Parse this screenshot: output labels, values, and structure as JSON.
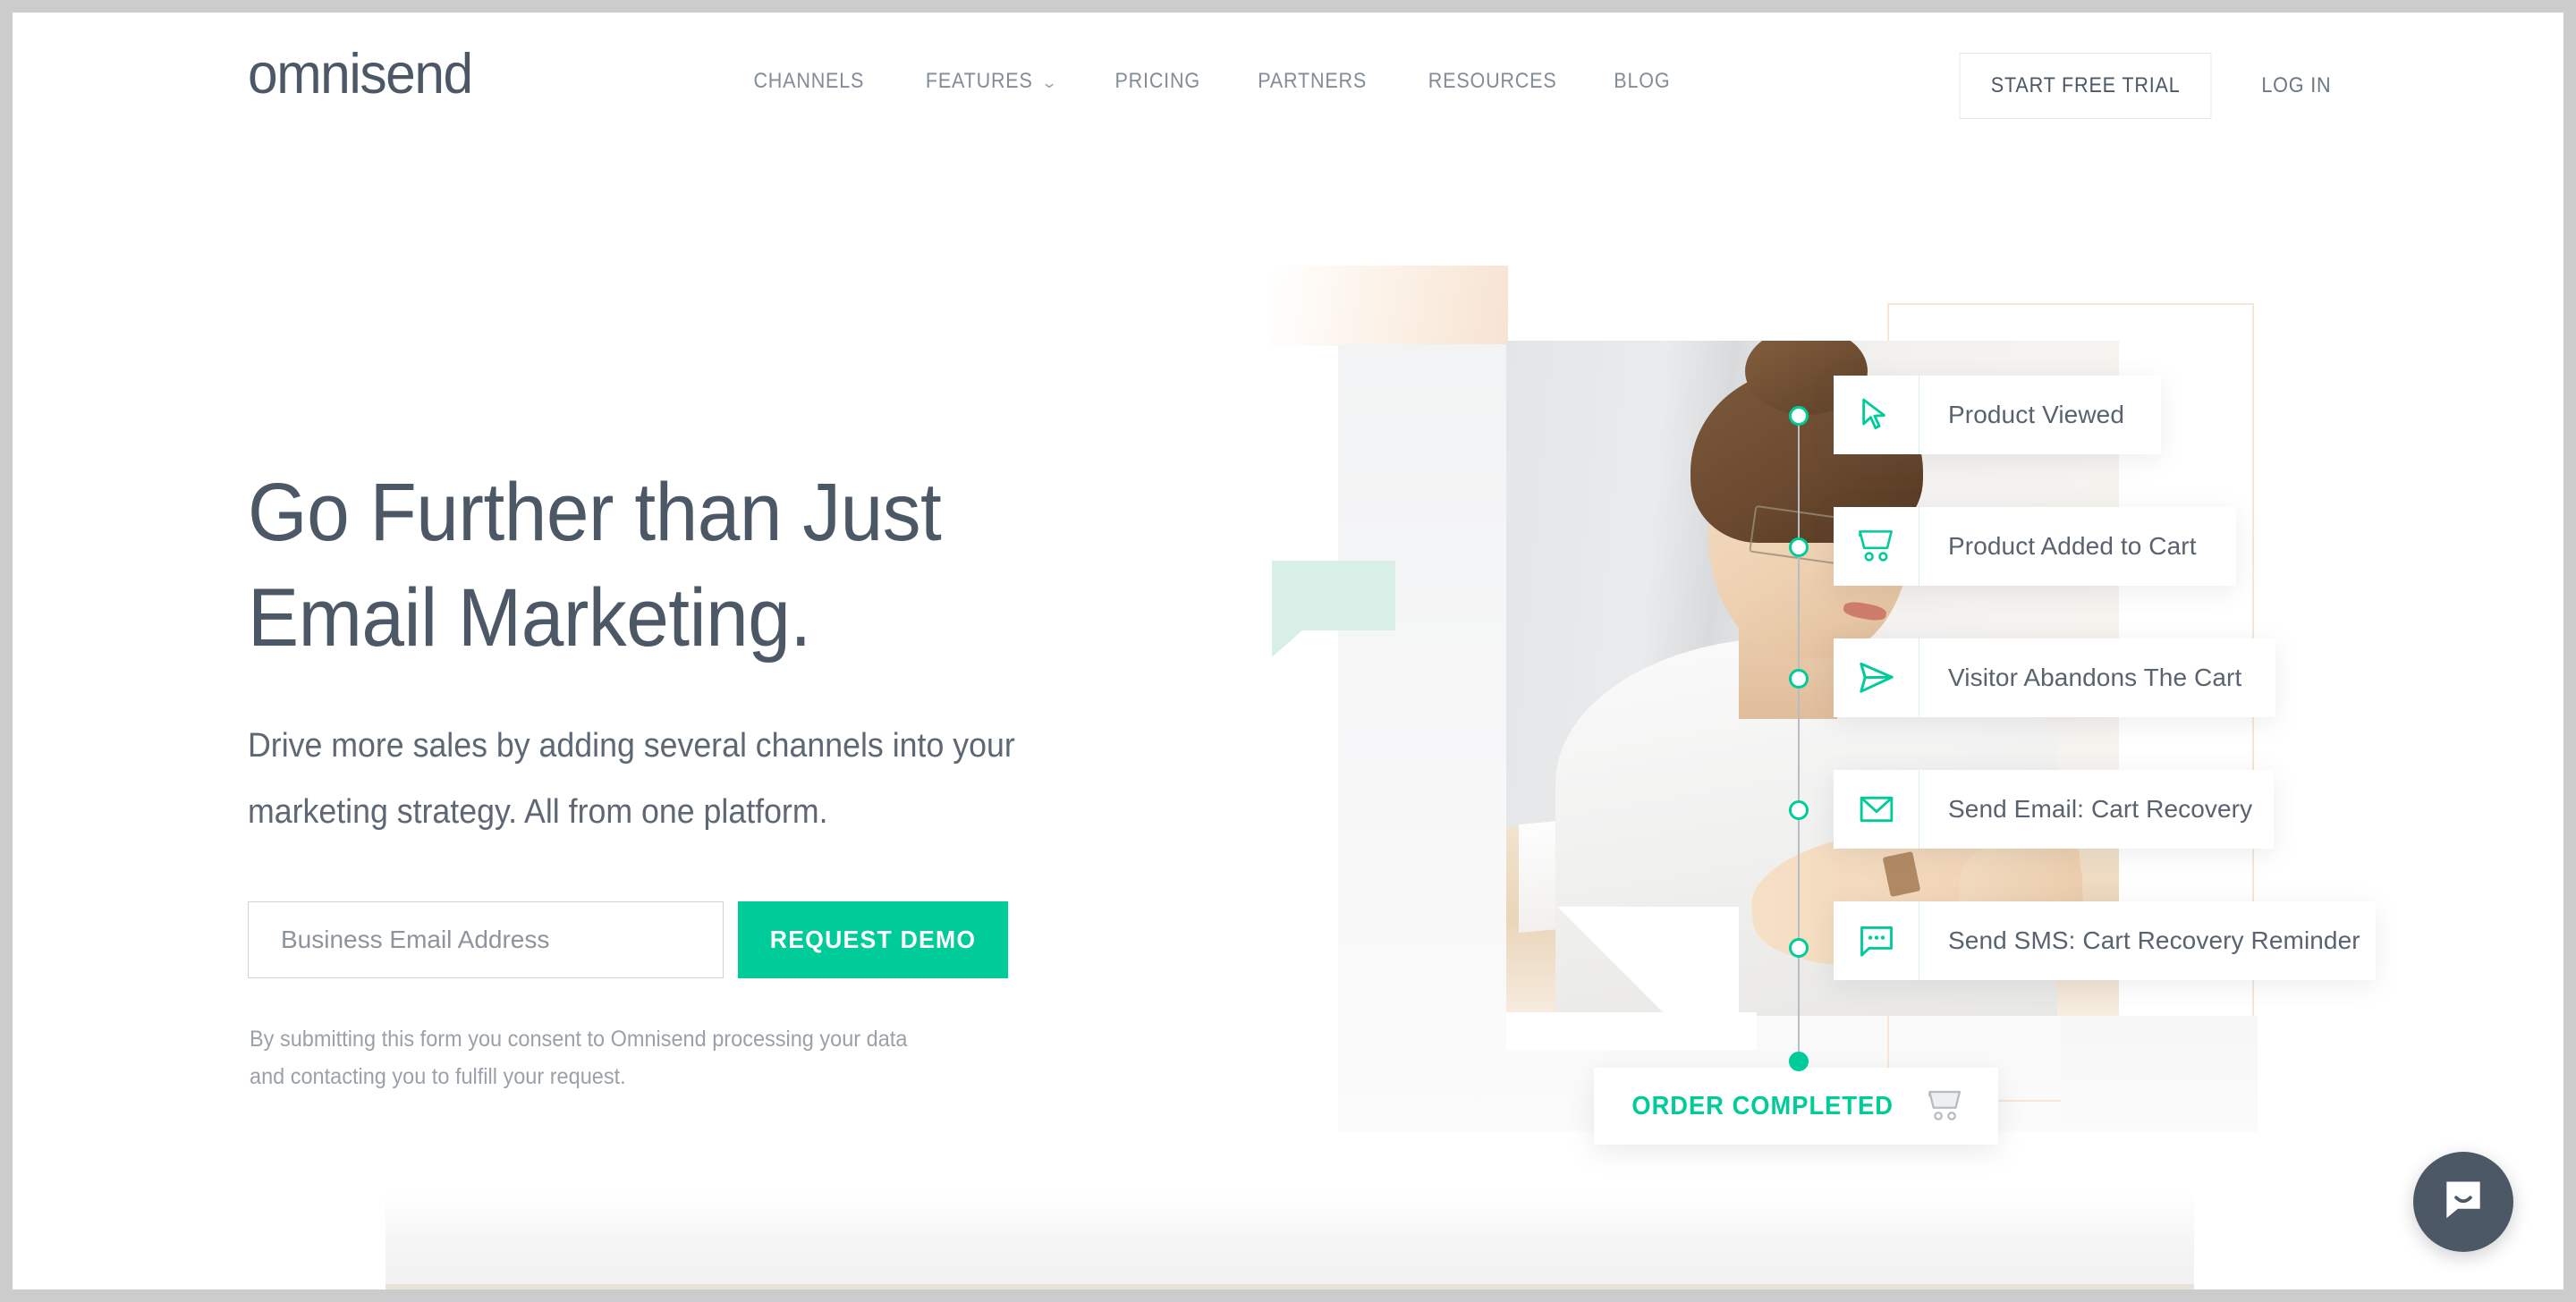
{
  "brand": {
    "logo_text": "omnisend",
    "accent_green": "#00CC99",
    "text_slate": "#4C5865",
    "peach_border": "#F0E4D8"
  },
  "header": {
    "nav": [
      {
        "label": "CHANNELS",
        "has_caret": false
      },
      {
        "label": "FEATURES",
        "has_caret": true,
        "caret": "⌄"
      },
      {
        "label": "PRICING",
        "has_caret": false
      },
      {
        "label": "PARTNERS",
        "has_caret": false
      },
      {
        "label": "RESOURCES",
        "has_caret": false
      },
      {
        "label": "BLOG",
        "has_caret": false
      }
    ],
    "start_free_trial": "START FREE TRIAL",
    "log_in": "LOG IN"
  },
  "hero": {
    "headline": "Go Further than Just Email Marketing.",
    "subheading": "Drive more sales by adding several channels into your marketing strategy. All from one platform.",
    "form": {
      "email_placeholder": "Business Email Address",
      "email_value": "",
      "submit_label": "REQUEST DEMO"
    },
    "consent": "By submitting this form you consent to Omnisend processing your data and contacting you to fulfill your request."
  },
  "workflow": {
    "steps": [
      {
        "label": "Product Viewed",
        "icon": "cursor-arrow-icon"
      },
      {
        "label": "Product Added to Cart",
        "icon": "shopping-cart-icon"
      },
      {
        "label": "Visitor Abandons The Cart",
        "icon": "paper-plane-icon"
      },
      {
        "label": "Send Email: Cart Recovery",
        "icon": "envelope-icon"
      },
      {
        "label": "Send SMS: Cart Recovery Reminder",
        "icon": "chat-bubble-icon"
      }
    ],
    "final_step": {
      "label": "ORDER COMPLETED",
      "icon": "shopping-cart-icon"
    }
  },
  "chat": {
    "launcher_icon": "intercom-chat-icon"
  }
}
